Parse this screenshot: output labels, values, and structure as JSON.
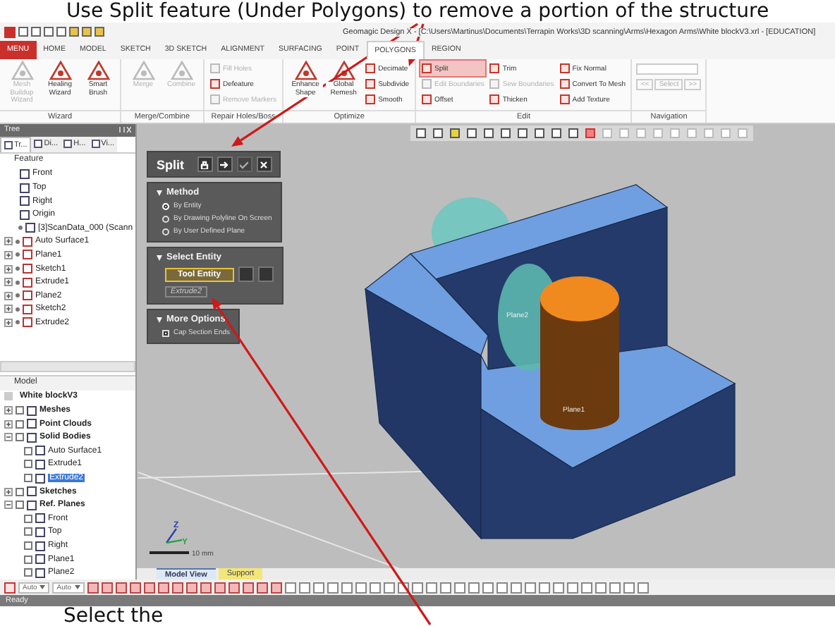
{
  "caption_top": "Use Split feature (Under Polygons) to remove a portion of the structure",
  "window": {
    "title": "Geomagic Design X - [C:\\Users\\Martinus\\Documents\\Terrapin Works\\3D scanning\\Arms\\Hexagon Arms\\White blockV3.xrl - [EDUCATION]"
  },
  "menu_tabs": [
    {
      "label": "MENU",
      "kind": "app",
      "selected": false
    },
    {
      "label": "HOME",
      "kind": "tab",
      "selected": false
    },
    {
      "label": "MODEL",
      "kind": "tab",
      "selected": false
    },
    {
      "label": "SKETCH",
      "kind": "tab",
      "selected": false
    },
    {
      "label": "3D SKETCH",
      "kind": "tab",
      "selected": false
    },
    {
      "label": "ALIGNMENT",
      "kind": "tab",
      "selected": false
    },
    {
      "label": "SURFACING",
      "kind": "tab",
      "selected": false
    },
    {
      "label": "POINT",
      "kind": "tab",
      "selected": false
    },
    {
      "label": "POLYGONS",
      "kind": "tab",
      "selected": true
    },
    {
      "label": "REGION",
      "kind": "tab",
      "selected": false
    }
  ],
  "ribbon": {
    "groups": [
      {
        "label": "Wizard",
        "kind": "tools",
        "tools": [
          {
            "label": "Mesh Buildup Wizard",
            "kind": "large",
            "disabled": true,
            "active": false
          },
          {
            "label": "Healing Wizard",
            "kind": "large",
            "disabled": false,
            "active": false
          },
          {
            "label": "Smart Brush",
            "kind": "large",
            "disabled": false,
            "active": false
          }
        ]
      },
      {
        "label": "Merge/Combine",
        "kind": "tools",
        "tools": [
          {
            "label": "Merge",
            "kind": "large",
            "disabled": true,
            "active": false
          },
          {
            "label": "Combine",
            "kind": "large",
            "disabled": true,
            "active": false
          }
        ]
      },
      {
        "label": "Repair Holes/Boss",
        "kind": "tools",
        "tools": [
          {
            "label": "Fill Holes",
            "kind": "small",
            "disabled": true,
            "active": false
          },
          {
            "label": "Defeature",
            "kind": "small",
            "disabled": false,
            "active": false
          },
          {
            "label": "Remove Markers",
            "kind": "small",
            "disabled": true,
            "active": false
          }
        ]
      },
      {
        "label": "Optimize",
        "kind": "tools",
        "tools": [
          {
            "label": "Enhance Shape",
            "kind": "large",
            "disabled": false,
            "active": false
          },
          {
            "label": "Global Remesh",
            "kind": "large",
            "disabled": false,
            "active": false
          },
          {
            "label": "Decimate",
            "kind": "small",
            "disabled": false,
            "active": false
          },
          {
            "label": "Subdivide",
            "kind": "small",
            "disabled": false,
            "active": false
          },
          {
            "label": "Smooth",
            "kind": "small",
            "disabled": false,
            "active": false
          }
        ]
      },
      {
        "label": "Edit",
        "kind": "tools",
        "tools": [
          {
            "label": "Split",
            "kind": "small",
            "disabled": false,
            "active": true
          },
          {
            "label": "Edit Boundaries",
            "kind": "small",
            "disabled": true,
            "active": false
          },
          {
            "label": "Offset",
            "kind": "small",
            "disabled": false,
            "active": false
          },
          {
            "label": "Trim",
            "kind": "small",
            "disabled": false,
            "active": false
          },
          {
            "label": "Sew Boundaries",
            "kind": "small",
            "disabled": true,
            "active": false
          },
          {
            "label": "Thicken",
            "kind": "small",
            "disabled": false,
            "active": false
          },
          {
            "label": "Fix Normal",
            "kind": "small",
            "disabled": false,
            "active": false
          },
          {
            "label": "Convert To Mesh",
            "kind": "small",
            "disabled": false,
            "active": false
          },
          {
            "label": "Add Texture",
            "kind": "small",
            "disabled": false,
            "active": false
          }
        ]
      },
      {
        "label": "Navigation",
        "kind": "navigation",
        "buttons": [
          {
            "label": "<<",
            "disabled": true
          },
          {
            "label": "Select",
            "disabled": true
          },
          {
            "label": ">>",
            "disabled": true
          }
        ]
      }
    ]
  },
  "tree_panel": {
    "title": "Tree",
    "tabs": [
      {
        "label": "Tr...",
        "selected": true
      },
      {
        "label": "Di...",
        "selected": false
      },
      {
        "label": "H...",
        "selected": false
      },
      {
        "label": "Vi...",
        "selected": false
      }
    ],
    "feature_header": "Feature",
    "features": [
      {
        "label": "Front",
        "kind": "leaf"
      },
      {
        "label": "Top",
        "kind": "leaf"
      },
      {
        "label": "Right",
        "kind": "leaf"
      },
      {
        "label": "Origin",
        "kind": "leaf"
      },
      {
        "label": "[3]ScanData_000 (Scann",
        "kind": "item"
      },
      {
        "label": "Auto Surface1",
        "kind": "node"
      },
      {
        "label": "Plane1",
        "kind": "node"
      },
      {
        "label": "Sketch1",
        "kind": "node"
      },
      {
        "label": "Extrude1",
        "kind": "node"
      },
      {
        "label": "Plane2",
        "kind": "node"
      },
      {
        "label": "Sketch2",
        "kind": "node"
      },
      {
        "label": "Extrude2",
        "kind": "node"
      }
    ]
  },
  "model_panel": {
    "title": "Model",
    "root": "White blockV3",
    "items": [
      {
        "label": "Meshes",
        "expanded": false,
        "selected": false
      },
      {
        "label": "Point Clouds",
        "expanded": false,
        "selected": false
      },
      {
        "label": "Solid Bodies",
        "expanded": true,
        "selected": false,
        "children": [
          {
            "label": "Auto Surface1",
            "selected": false
          },
          {
            "label": "Extrude1",
            "selected": false
          },
          {
            "label": "Extrude2",
            "selected": true
          }
        ]
      },
      {
        "label": "Sketches",
        "expanded": false,
        "selected": false
      },
      {
        "label": "Ref. Planes",
        "expanded": true,
        "selected": false,
        "children": [
          {
            "label": "Front",
            "selected": false
          },
          {
            "label": "Top",
            "selected": false
          },
          {
            "label": "Right",
            "selected": false
          },
          {
            "label": "Plane1",
            "selected": false
          },
          {
            "label": "Plane2",
            "selected": false
          }
        ]
      }
    ]
  },
  "split_panel": {
    "title": "Split",
    "sections": [
      {
        "title": "Method",
        "kind": "radios",
        "options": [
          {
            "label": "By Entity",
            "selected": true
          },
          {
            "label": "By Drawing Polyline On Screen",
            "selected": false
          },
          {
            "label": "By User Defined Plane",
            "selected": false
          }
        ]
      },
      {
        "title": "Select Entity",
        "kind": "entity",
        "button": "Tool Entity",
        "value": "Extrude2"
      },
      {
        "title": "More Options",
        "kind": "checks",
        "options": [
          {
            "label": "Cap Section Ends",
            "checked": true
          }
        ]
      }
    ]
  },
  "viewport": {
    "plane_labels": [
      "Plane2",
      "Plane1"
    ],
    "axes": [
      "Z",
      "Y"
    ],
    "scale": "10 mm"
  },
  "view_tabs": [
    {
      "label": "Model View",
      "selected": true,
      "color": "#dce8f6"
    },
    {
      "label": "Support",
      "selected": false,
      "color": "#f2e67a"
    }
  ],
  "bottom_toolbar": {
    "dropdowns": [
      "Auto",
      "Auto"
    ]
  },
  "status_bar": "Ready",
  "caption_bottom": "Select the"
}
